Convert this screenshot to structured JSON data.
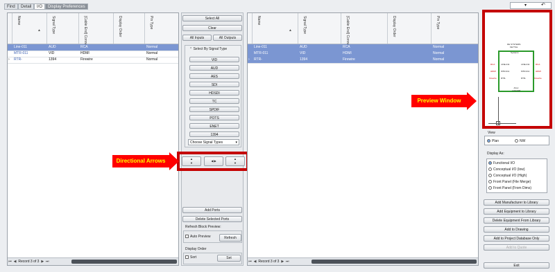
{
  "tabs": [
    "Find",
    "Detail",
    "I/O",
    "Display Preferences"
  ],
  "top_right": {
    "dropdown_icon": "chevron-down-icon",
    "undo_icon": "undo-icon"
  },
  "left_grid": {
    "columns": [
      "Name",
      "Signal Type",
      "[Cable End] Connector",
      "Display Order",
      "Pin Type"
    ],
    "rows": [
      [
        "Line-011",
        "AUD",
        "RCA",
        "",
        "Normal"
      ],
      [
        "MTR-011",
        "VID",
        "HDMI",
        "",
        "Normal"
      ],
      [
        "RTR-",
        "1394",
        "Firewire",
        "",
        "Normal"
      ]
    ],
    "pager": "Record 3 of 3"
  },
  "right_grid": {
    "columns": [
      "Name",
      "Signal Type",
      "[Cable End] Connector",
      "Display Order",
      "Pin Type"
    ],
    "rows": [
      [
        "Line-011",
        "AUD",
        "RCA",
        "",
        "Normal"
      ],
      [
        "MTR-011",
        "VID",
        "HDMI",
        "",
        "Normal"
      ],
      [
        "RTR-",
        "1394",
        "Firewire",
        "",
        "Normal"
      ]
    ],
    "pager": "Record 3 of 3"
  },
  "middle": {
    "select_all": "Select All",
    "clear": "Clear",
    "all_inputs": "All Inputs",
    "all_outputs": "All Outputs",
    "select_by_signal": "Select By Signal Type",
    "signal_types": [
      "VID",
      "AUD",
      "AES",
      "SDI",
      "HDSDI",
      "TC",
      "SPDIF",
      "POTS",
      "ENET",
      "1394"
    ],
    "choose_signal": "Choose Signal Types",
    "add_ports": "Add Ports",
    "delete_ports": "Delete Selected Ports",
    "refresh_block": "Refresh Block Preview:",
    "auto_preview": "Auto Preview",
    "refresh": "Refresh",
    "display_order": "Display Order",
    "sort": "Sort",
    "set": "Set"
  },
  "callouts": {
    "directional": "Directional Arrows",
    "preview": "Preview Window"
  },
  "preview": {
    "title_lines": [
      "DE SYSTEMS",
      "KEYTEL"
    ],
    "center_label": "Systems",
    "bottom_labels": [
      "Artec",
      "LOGO08"
    ],
    "left_ports": [
      "RCA",
      "HDMI",
      "Firewire"
    ],
    "inner_left": [
      "LINE-011",
      "MTR-011",
      "RTR-"
    ],
    "inner_right": [
      "LINE-011",
      "MTR-011",
      "RTR-"
    ],
    "right_ports": [
      "RCA",
      "HDMI",
      "Firewire"
    ]
  },
  "view": {
    "label": "View",
    "plan": "Plan",
    "nw": "NW"
  },
  "display_as": {
    "label": "Display As:",
    "options": [
      "Functional I/O",
      "Conceptual I/O (low)",
      "Conceptual I/O (High)",
      "Front Panel (File Merge)",
      "Front Panel (From Dims)"
    ]
  },
  "actions": [
    "Add Manufacturer to Library",
    "Add Equipment to Library",
    "Delete Equipment From Library",
    "Add to Drawing",
    "Add to Project Database Only",
    "Add to Quote"
  ],
  "exit": "Exit",
  "colors": {
    "highlight": "#7b96d2",
    "callout": "#ff0000",
    "box": "#c40000",
    "preview_box": "#2a9a2a"
  }
}
